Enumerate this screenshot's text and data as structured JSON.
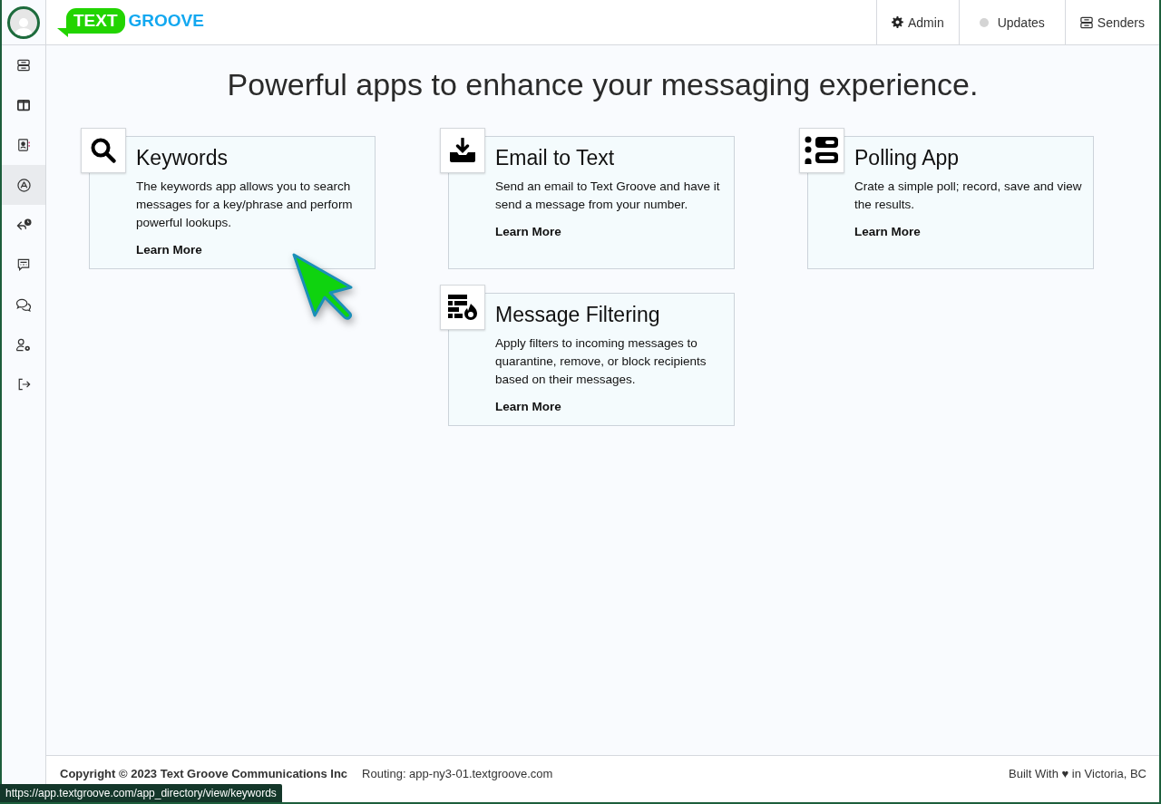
{
  "header": {
    "logo": {
      "badge": "TEXT",
      "word": "GROOVE"
    },
    "nav": [
      {
        "label": "Admin"
      },
      {
        "label": "Updates"
      },
      {
        "label": "Senders"
      }
    ]
  },
  "sidebar": {
    "items": [
      {
        "selected": false
      },
      {
        "selected": false
      },
      {
        "selected": false
      },
      {
        "selected": true
      },
      {
        "selected": false
      },
      {
        "selected": false
      },
      {
        "selected": false
      },
      {
        "selected": false
      },
      {
        "selected": false
      }
    ]
  },
  "heading": "Powerful apps to enhance your messaging experience.",
  "app_columns": [
    [
      {
        "title": "Keywords",
        "description": "The keywords app allows you to search messages for a key/phrase and perform powerful lookups.",
        "link": "Learn More"
      }
    ],
    [
      {
        "title": "Email to Text",
        "description": "Send an email to Text Groove and have it send a message from your number.",
        "link": "Learn More"
      },
      {
        "title": "Message Filtering",
        "description": "Apply filters to incoming messages to quarantine, remove, or block recipients based on their messages.",
        "link": "Learn More"
      }
    ],
    [
      {
        "title": "Polling App",
        "description": "Crate a simple poll; record, save and view the results.",
        "link": "Learn More"
      }
    ]
  ],
  "footer": {
    "copyright": "Copyright © 2023 Text Groove Communications Inc",
    "routing": "Routing: app-ny3-01.textgroove.com",
    "credit": "Built With ♥ in Victoria, BC"
  },
  "status_url": "https://app.textgroove.com/app_directory/view/keywords"
}
